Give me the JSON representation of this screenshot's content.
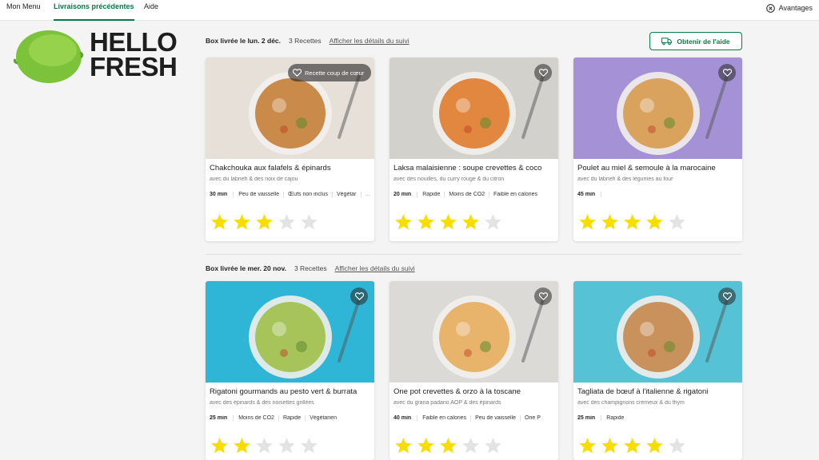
{
  "nav": {
    "tabs": [
      {
        "label": "Mon Menu",
        "active": false
      },
      {
        "label": "Livraisons précédentes",
        "active": true
      },
      {
        "label": "Aide",
        "active": false
      }
    ],
    "advantages_label": "Avantages"
  },
  "logo": {
    "line1": "HELLO",
    "line2": "FRESH"
  },
  "help_button_label": "Obtenir de l'aide",
  "colors": {
    "accent_green": "#067a46",
    "star_filled": "#f9dc00",
    "star_empty": "#e3e3e3"
  },
  "boxes": [
    {
      "date_label": "Box livrée le lun. 2 déc.",
      "count_label": "3 Recettes",
      "tracking_label": "Afficher les détails du suivi",
      "recipes": [
        {
          "title": "Chakchouka aux falafels & épinards",
          "subtitle": "avec du labneh & des noix de cajou",
          "time": "30 min",
          "tags": [
            "Peu de vaisselle",
            "Œufs non inclus",
            "Végétar"
          ],
          "more": "...",
          "rating": 3,
          "favorite_label": "Recette coup de cœur",
          "bg": "#e7e0d9",
          "plate": "#c98a4a"
        },
        {
          "title": "Laksa malaisienne : soupe crevettes & coco",
          "subtitle": "avec des nouilles, du curry rouge & du citron",
          "time": "20 min",
          "tags": [
            "Rapide",
            "Moins de CO2",
            "Faible en calories"
          ],
          "more": "",
          "rating": 4,
          "favorite_label": "",
          "bg": "#d3d1cc",
          "plate": "#e2873f"
        },
        {
          "title": "Poulet au miel & semoule à la marocaine",
          "subtitle": "avec du labneh & des légumes au four",
          "time": "45 min",
          "tags": [],
          "more": "",
          "rating": 4,
          "favorite_label": "",
          "bg": "#a592d6",
          "plate": "#d9a35e"
        }
      ]
    },
    {
      "date_label": "Box livrée le mer. 20 nov.",
      "count_label": "3 Recettes",
      "tracking_label": "Afficher les détails du suivi",
      "recipes": [
        {
          "title": "Rigatoni gourmands au pesto vert & burrata",
          "subtitle": "avec des épinards & des noisettes grillées",
          "time": "25 min",
          "tags": [
            "Moins de CO2",
            "Rapide",
            "Végétarien"
          ],
          "more": "",
          "rating": 2,
          "favorite_label": "",
          "bg": "#2fb6d6",
          "plate": "#a6c45a"
        },
        {
          "title": "One pot crevettes & orzo à la toscane",
          "subtitle": "avec du grana padano AOP & des épinards",
          "time": "40 min",
          "tags": [
            "Faible en calories",
            "Peu de vaisselle",
            "One P"
          ],
          "more": "",
          "rating": 3,
          "favorite_label": "",
          "bg": "#dcdad6",
          "plate": "#e8b36a"
        },
        {
          "title": "Tagliata de bœuf à l'italienne & rigatoni",
          "subtitle": "avec des champignons crémeux & du thym",
          "time": "25 min",
          "tags": [
            "Rapide"
          ],
          "more": "",
          "rating": 4,
          "favorite_label": "",
          "bg": "#56c2d6",
          "plate": "#c9925c"
        }
      ]
    }
  ]
}
